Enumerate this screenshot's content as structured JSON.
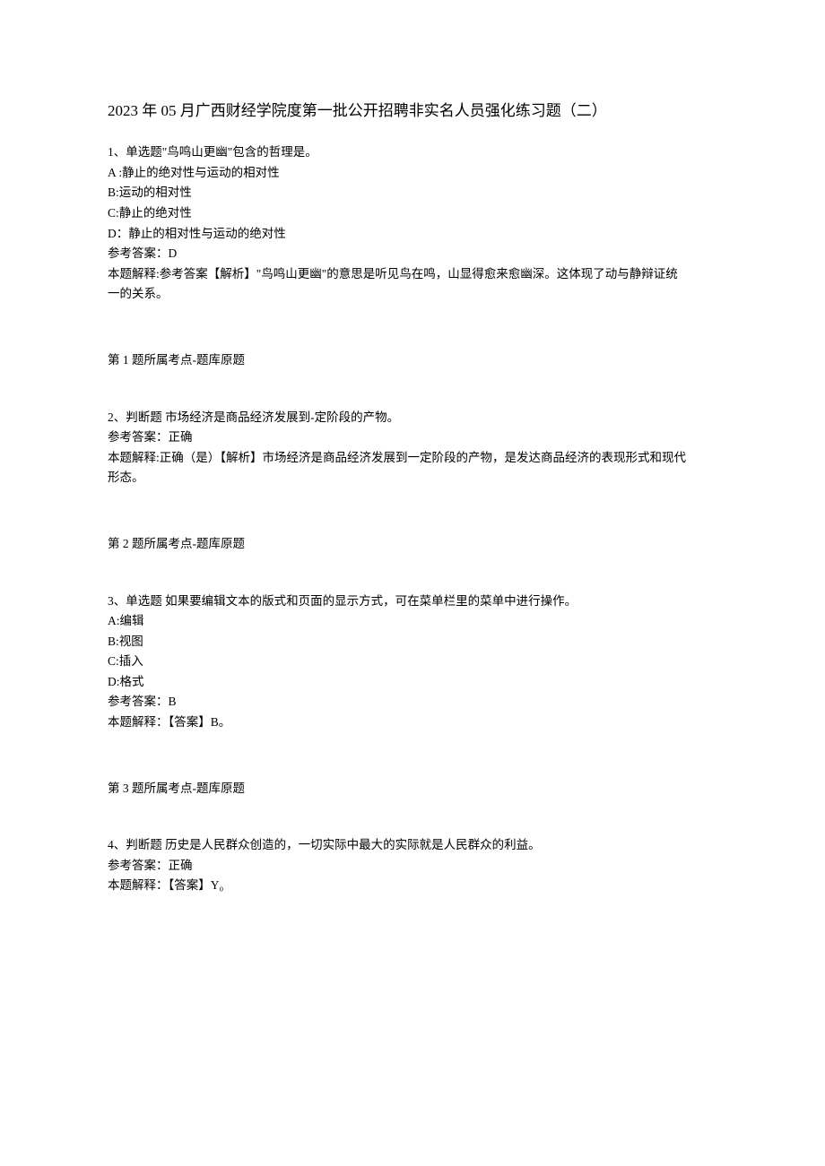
{
  "title": "2023 年 05 月广西财经学院度第一批公开招聘非实名人员强化练习题（二）",
  "q1": {
    "stem": "1、单选题\"鸟鸣山更幽\"包含的哲理是。",
    "optA": "A :静止的绝对性与运动的相对性",
    "optB": "B:运动的相对性",
    "optC": "C:静止的绝对性",
    "optD": "D：静止的相对性与运动的绝对性",
    "ans": "参考答案：D",
    "expl1": "本题解释:参考答案【解析】\"鸟鸣山更幽\"的意思是听见鸟在鸣，山显得愈来愈幽深。这体现了动与静辩证统",
    "expl2": "一的关系。",
    "topic": "第 1 题所属考点-题库原题"
  },
  "q2": {
    "stem": "2、判断题      市场经济是商品经济发展到-定阶段的产物。",
    "ans": "参考答案：正确",
    "expl1": "本题解释:正确（是）【解析】市场经济是商品经济发展到一定阶段的产物，是发达商品经济的表现形式和现代",
    "expl2": "形态。",
    "topic": "第 2 题所属考点-题库原题"
  },
  "q3": {
    "stem": "3、单选题      如果要编辑文本的版式和页面的显示方式，可在菜单栏里的菜单中进行操作。",
    "optA": "A:编辑",
    "optB": "B:视图",
    "optC": "C:插入",
    "optD": "D:格式",
    "ans": "参考答案：B",
    "expl": "本题解释：【答案】B。",
    "topic": "第 3 题所属考点-题库原题"
  },
  "q4": {
    "stem": "4、判断题      历史是人民群众创造的，一切实际中最大的实际就是人民群众的利益。",
    "ans": "参考答案：正确",
    "expl": "本题解释：【答案】Y₀"
  }
}
